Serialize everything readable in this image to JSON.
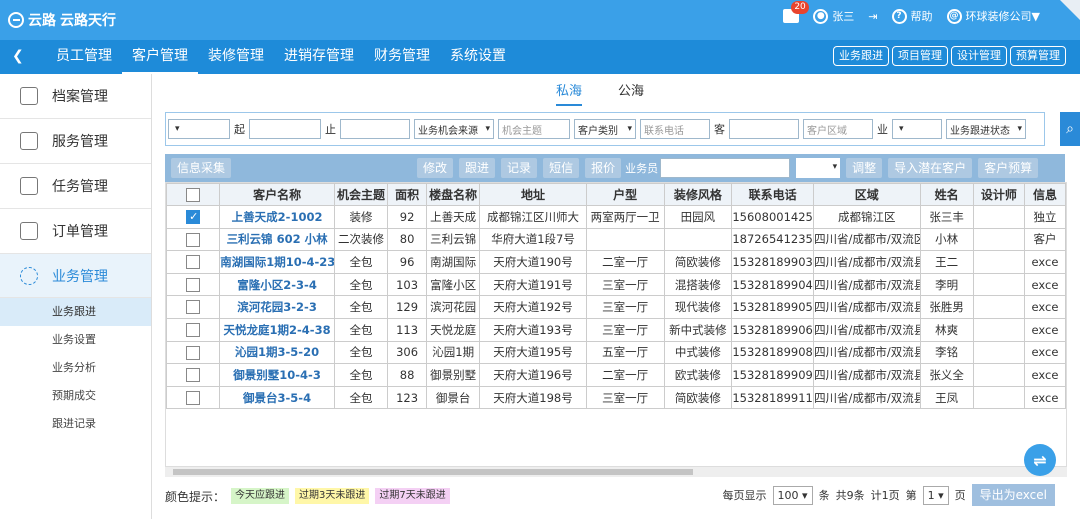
{
  "brand": {
    "name": "云路天行",
    "logo_text": "云路"
  },
  "topbar": {
    "msg_count": "20",
    "user": "张三",
    "help": "帮助",
    "company": "环球装修公司▼"
  },
  "nav": {
    "tabs": [
      "员工管理",
      "客户管理",
      "装修管理",
      "进销存管理",
      "财务管理",
      "系统设置"
    ],
    "active": 1,
    "quick": [
      "业务跟进",
      "项目管理",
      "设计管理",
      "预算管理"
    ]
  },
  "sidebar": {
    "items": [
      "档案管理",
      "服务管理",
      "任务管理",
      "订单管理",
      "业务管理"
    ],
    "active": 4,
    "subs": [
      "业务跟进",
      "业务设置",
      "业务分析",
      "预期成交",
      "跟进记录"
    ],
    "active_sub": 0
  },
  "seatabs": [
    "私海",
    "公海"
  ],
  "filter": {
    "start": "起",
    "end": "止",
    "source": "业务机会来源",
    "topic": "机会主题",
    "ctype": "客户类别",
    "phone": "联系电话",
    "cust": "客",
    "area": "客户区域",
    "biz": "业",
    "status": "业务跟进状态"
  },
  "toolbar": {
    "collect": "信息采集",
    "buttons": [
      "修改",
      "跟进",
      "记录",
      "短信",
      "报价"
    ],
    "staff": "业务员",
    "adjust": "调整",
    "import": "导入潜在客户",
    "budget": "客户预算"
  },
  "table": {
    "headers": [
      "客户名称",
      "机会主题",
      "面积",
      "楼盘名称",
      "地址",
      "户型",
      "装修风格",
      "联系电话",
      "区域",
      "姓名",
      "设计师",
      "信息"
    ],
    "rows": [
      {
        "checked": true,
        "c": [
          "上善天成2-1002",
          "装修",
          "92",
          "上善天成",
          "成都锦江区川师大",
          "两室两厅一卫",
          "田园风",
          "15608001425",
          "成都锦江区",
          "张三丰",
          "",
          "独立"
        ]
      },
      {
        "checked": false,
        "c": [
          "三利云锦 602 小林",
          "二次装修",
          "80",
          "三利云锦",
          "华府大道1段7号",
          "",
          "",
          "18726541235",
          "四川省/成都市/双流区",
          "小林",
          "",
          "客户"
        ]
      },
      {
        "checked": false,
        "c": [
          "南湖国际1期10-4-23",
          "全包",
          "96",
          "南湖国际",
          "天府大道190号",
          "二室一厅",
          "简欧装修",
          "15328189903",
          "四川省/成都市/双流县",
          "王二",
          "",
          "exce"
        ]
      },
      {
        "checked": false,
        "c": [
          "富隆小区2-3-4",
          "全包",
          "103",
          "富隆小区",
          "天府大道191号",
          "三室一厅",
          "混搭装修",
          "15328189904",
          "四川省/成都市/双流县",
          "李明",
          "",
          "exce"
        ]
      },
      {
        "checked": false,
        "c": [
          "滨河花园3-2-3",
          "全包",
          "129",
          "滨河花园",
          "天府大道192号",
          "三室一厅",
          "现代装修",
          "15328189905",
          "四川省/成都市/双流县",
          "张胜男",
          "",
          "exce"
        ]
      },
      {
        "checked": false,
        "c": [
          "天悦龙庭1期2-4-38",
          "全包",
          "113",
          "天悦龙庭",
          "天府大道193号",
          "三室一厅",
          "新中式装修",
          "15328189906",
          "四川省/成都市/双流县",
          "林爽",
          "",
          "exce"
        ]
      },
      {
        "checked": false,
        "c": [
          "沁园1期3-5-20",
          "全包",
          "306",
          "沁园1期",
          "天府大道195号",
          "五室一厅",
          "中式装修",
          "15328189908",
          "四川省/成都市/双流县",
          "李铭",
          "",
          "exce"
        ]
      },
      {
        "checked": false,
        "c": [
          "御景别墅10-4-3",
          "全包",
          "88",
          "御景别墅",
          "天府大道196号",
          "二室一厅",
          "欧式装修",
          "15328189909",
          "四川省/成都市/双流县",
          "张义全",
          "",
          "exce"
        ]
      },
      {
        "checked": false,
        "c": [
          "御景台3-5-4",
          "全包",
          "123",
          "御景台",
          "天府大道198号",
          "三室一厅",
          "简欧装修",
          "15328189911",
          "四川省/成都市/双流县",
          "王凤",
          "",
          "exce"
        ]
      }
    ]
  },
  "footer": {
    "legend": "颜色提示：",
    "tags": [
      {
        "t": "今天应跟进",
        "c": "#d6f5c8"
      },
      {
        "t": "过期3天未跟进",
        "c": "#fff7a8"
      },
      {
        "t": "过期7天未跟进",
        "c": "#f4d0f4"
      }
    ],
    "perpage_label": "每页显示",
    "perpage": "100",
    "unit": "条",
    "total": "共9条",
    "pages": "计1页",
    "page_pre": "第",
    "page": "1",
    "page_post": "页",
    "export": "导出为excel"
  },
  "colors": {
    "top": "#3aa0e8",
    "nav": "#1e8bd9",
    "accent": "#2a8ad8"
  }
}
